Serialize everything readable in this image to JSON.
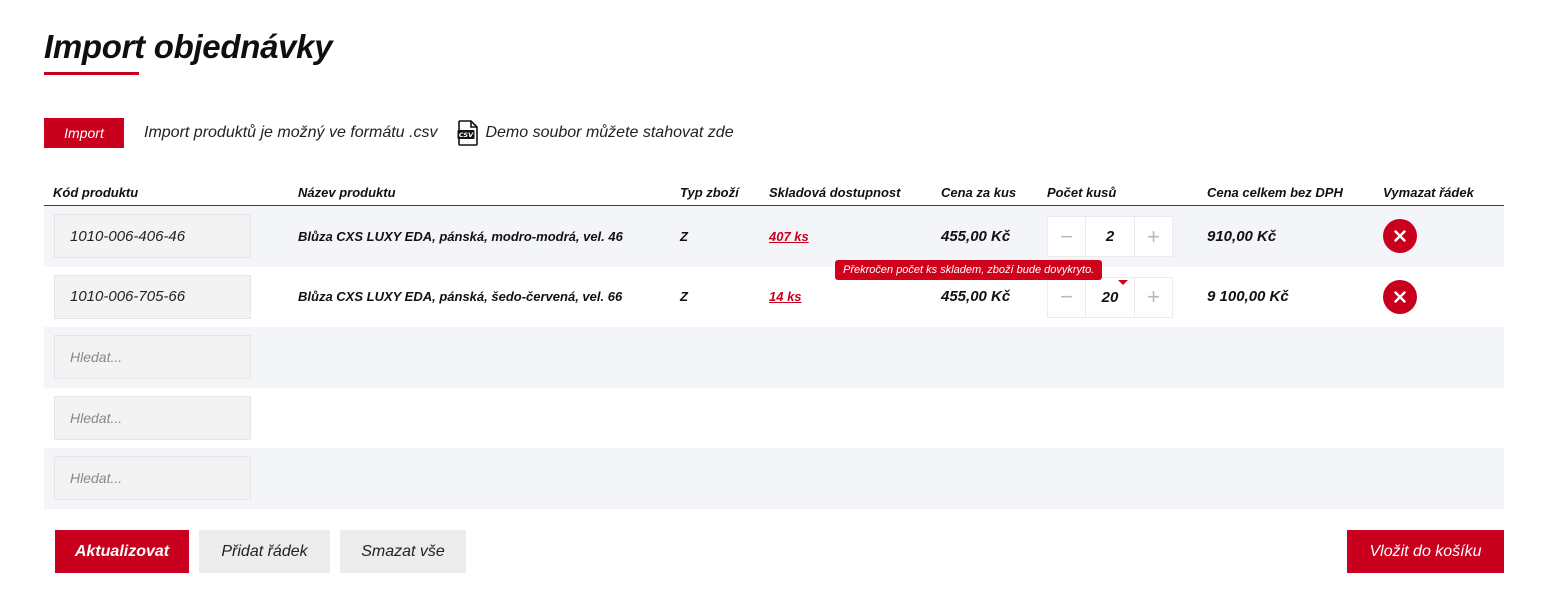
{
  "page": {
    "title": "Import objednávky"
  },
  "import": {
    "button_label": "Import",
    "note": "Import produktů je možný ve formátu .csv",
    "demo_link": "Demo soubor můžete stahovat zde",
    "demo_icon": "csv-file-icon"
  },
  "table": {
    "headers": {
      "code": "Kód produktu",
      "name": "Název produktu",
      "type": "Typ zboží",
      "stock": "Skladová dostupnost",
      "price": "Cena za kus",
      "qty": "Počet kusů",
      "total": "Cena celkem bez DPH",
      "delete": "Vymazat řádek"
    },
    "rows": [
      {
        "code": "1010-006-406-46",
        "name": "Blůza CXS LUXY EDA, pánská, modro-modrá, vel. 46",
        "type": "Z",
        "stock": "407 ks",
        "price": "455,00 Kč",
        "qty": "2",
        "total": "910,00 Kč"
      },
      {
        "code": "1010-006-705-66",
        "name": "Blůza CXS LUXY EDA, pánská, šedo-červená, vel. 66",
        "type": "Z",
        "stock": "14 ks",
        "price": "455,00 Kč",
        "qty": "20",
        "total": "9 100,00 Kč",
        "warning": "Překročen počet ks skladem, zboží bude dovykryto."
      }
    ],
    "search_placeholder": "Hledat...",
    "qty_minus": "−",
    "qty_plus": "+"
  },
  "actions": {
    "update": "Aktualizovat",
    "add_row": "Přidat řádek",
    "clear_all": "Smazat vše",
    "add_to_cart": "Vložit do košíku"
  },
  "colors": {
    "accent": "#c8001e",
    "row_shade": "#f3f5f9"
  }
}
